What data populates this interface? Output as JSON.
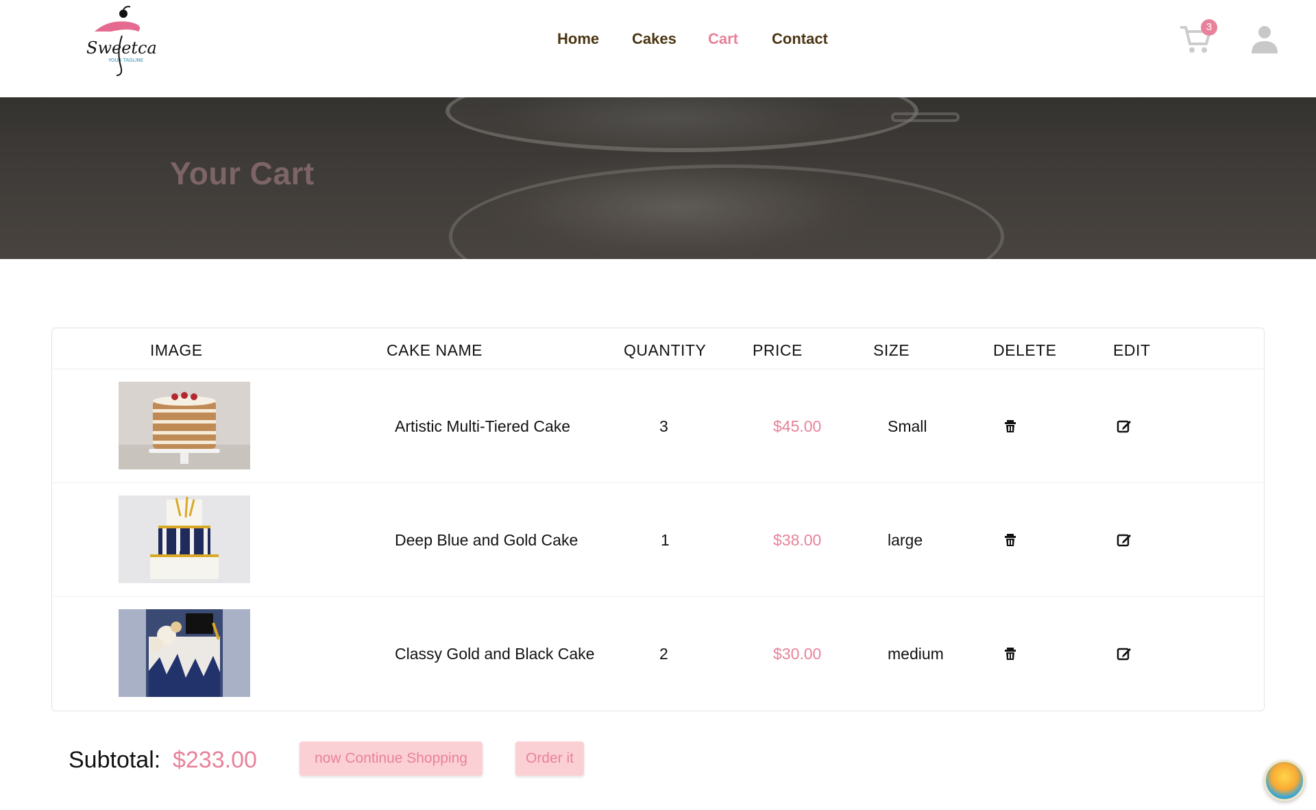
{
  "header": {
    "logo": {
      "name": "Sweetcake",
      "tagline": "YOUR TAGLINE",
      "icon": "cake-logo"
    },
    "nav": [
      {
        "label": "Home",
        "active": false
      },
      {
        "label": "Cakes",
        "active": false
      },
      {
        "label": "Cart",
        "active": true
      },
      {
        "label": "Contact",
        "active": false
      }
    ],
    "cart_count": "3",
    "cart_icon": "cart-icon",
    "user_icon": "user-icon"
  },
  "hero": {
    "title": "Your Cart"
  },
  "table": {
    "headers": [
      "IMAGE",
      "CAKE NAME",
      "QUANTITY",
      "PRICE",
      "SIZE",
      "DELETE",
      "EDIT"
    ],
    "rows": [
      {
        "name": "Artistic Multi-Tiered Cake",
        "quantity": "3",
        "price": "$45.00",
        "size": "Small",
        "image": "naked-layer-cake"
      },
      {
        "name": "Deep Blue and Gold Cake",
        "quantity": "1",
        "price": "$38.00",
        "size": "large",
        "image": "blue-gold-tier-cake"
      },
      {
        "name": "Classy Gold and Black Cake",
        "quantity": "2",
        "price": "$30.00",
        "size": "medium",
        "image": "black-gold-cake"
      }
    ],
    "delete_icon": "trash-icon",
    "edit_icon": "edit-icon"
  },
  "footer": {
    "subtotal_label": "Subtotal:",
    "subtotal_value": "$233.00",
    "continue_label": "now Continue Shopping",
    "order_label": "Order it"
  },
  "colors": {
    "accent": "#e8829a",
    "nav_text": "#4a3512",
    "button_bg": "#fbd0d5"
  }
}
